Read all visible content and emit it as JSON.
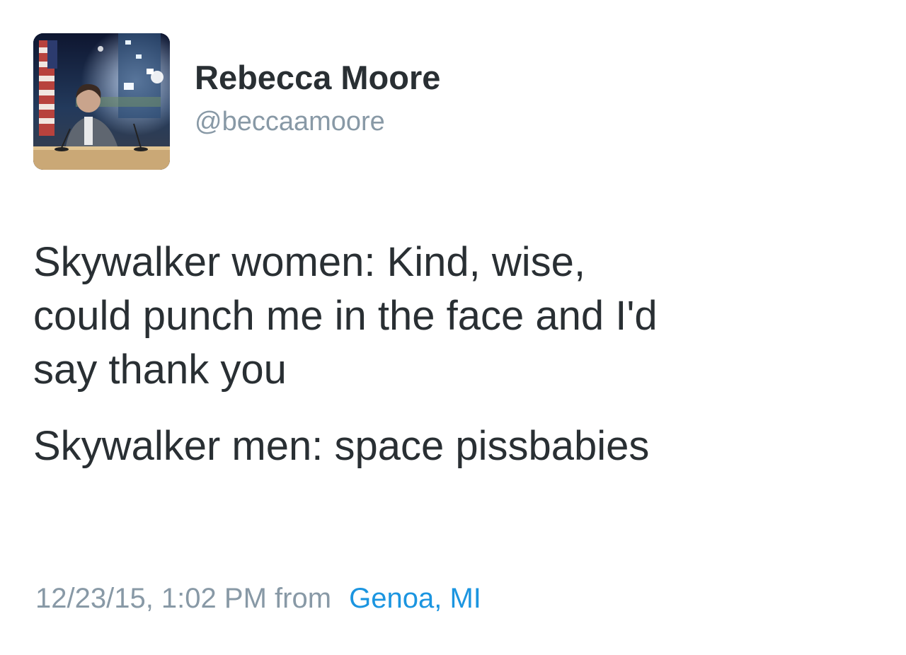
{
  "user": {
    "display_name": "Rebecca Moore",
    "handle": "@beccaamoore",
    "avatar": "profile-photo"
  },
  "tweet": {
    "lines": [
      "Skywalker women: Kind, wise,",
      "could punch me in the face and I'd",
      "say thank you",
      "Skywalker men: space pissbabies"
    ],
    "timestamp": "12/23/15, 1:02 PM",
    "from_label": "from",
    "location": "Genoa, MI"
  },
  "colors": {
    "text": "#292f33",
    "secondary": "#8899a6",
    "link": "#1b95e0",
    "background": "#ffffff"
  }
}
